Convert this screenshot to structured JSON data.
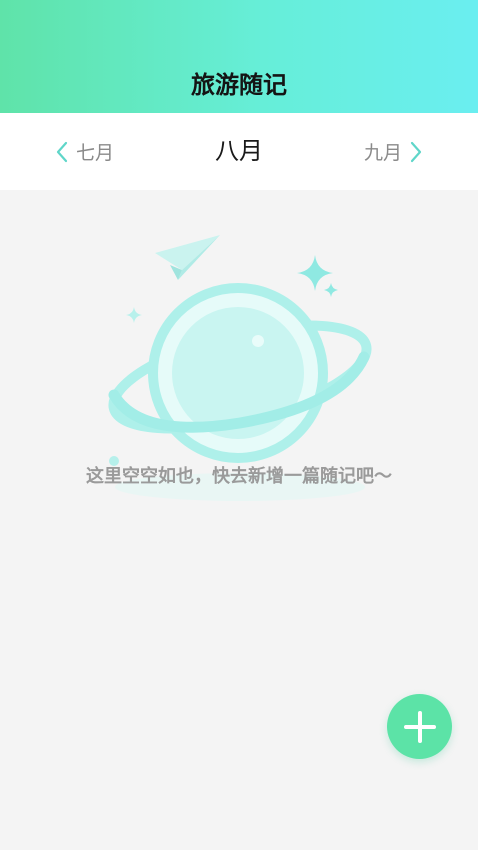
{
  "header": {
    "title": "旅游随记"
  },
  "month_nav": {
    "prev_label": "七月",
    "current_label": "八月",
    "next_label": "九月"
  },
  "empty_state": {
    "message": "这里空空如也，快去新增一篇随记吧～"
  },
  "colors": {
    "accent": "#5ce3a7",
    "header_gradient_start": "#5fe3a9",
    "header_gradient_end": "#6aeef0",
    "illustration": "#a7f0ec",
    "chevron": "#5fd6c9"
  },
  "icons": {
    "prev": "chevron-left-icon",
    "next": "chevron-right-icon",
    "fab": "plus-icon",
    "illustration": "planet-illustration"
  }
}
